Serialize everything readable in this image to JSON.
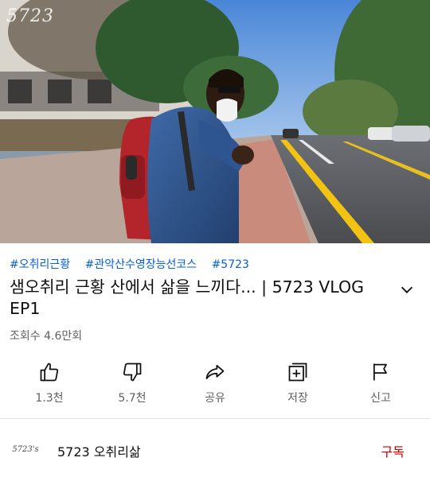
{
  "video": {
    "watermark": "5723"
  },
  "hashtags": [
    "#오취리근황",
    "#관악산수영장능선코스",
    "#5723"
  ],
  "title": "샘오취리 근황 산에서 삶을 느끼다... | 5723 VLOG EP1",
  "views": "조회수 4.6만회",
  "actions": {
    "like": "1.3천",
    "dislike": "5.7천",
    "share": "공유",
    "save": "저장",
    "report": "신고"
  },
  "channel": {
    "avatar_text": "5723's",
    "name": "5723 오취리삶",
    "subscribe_label": "구독"
  },
  "colors": {
    "hashtag": "#065fd4",
    "subscribe": "#cc0000",
    "secondary_text": "#606060"
  }
}
